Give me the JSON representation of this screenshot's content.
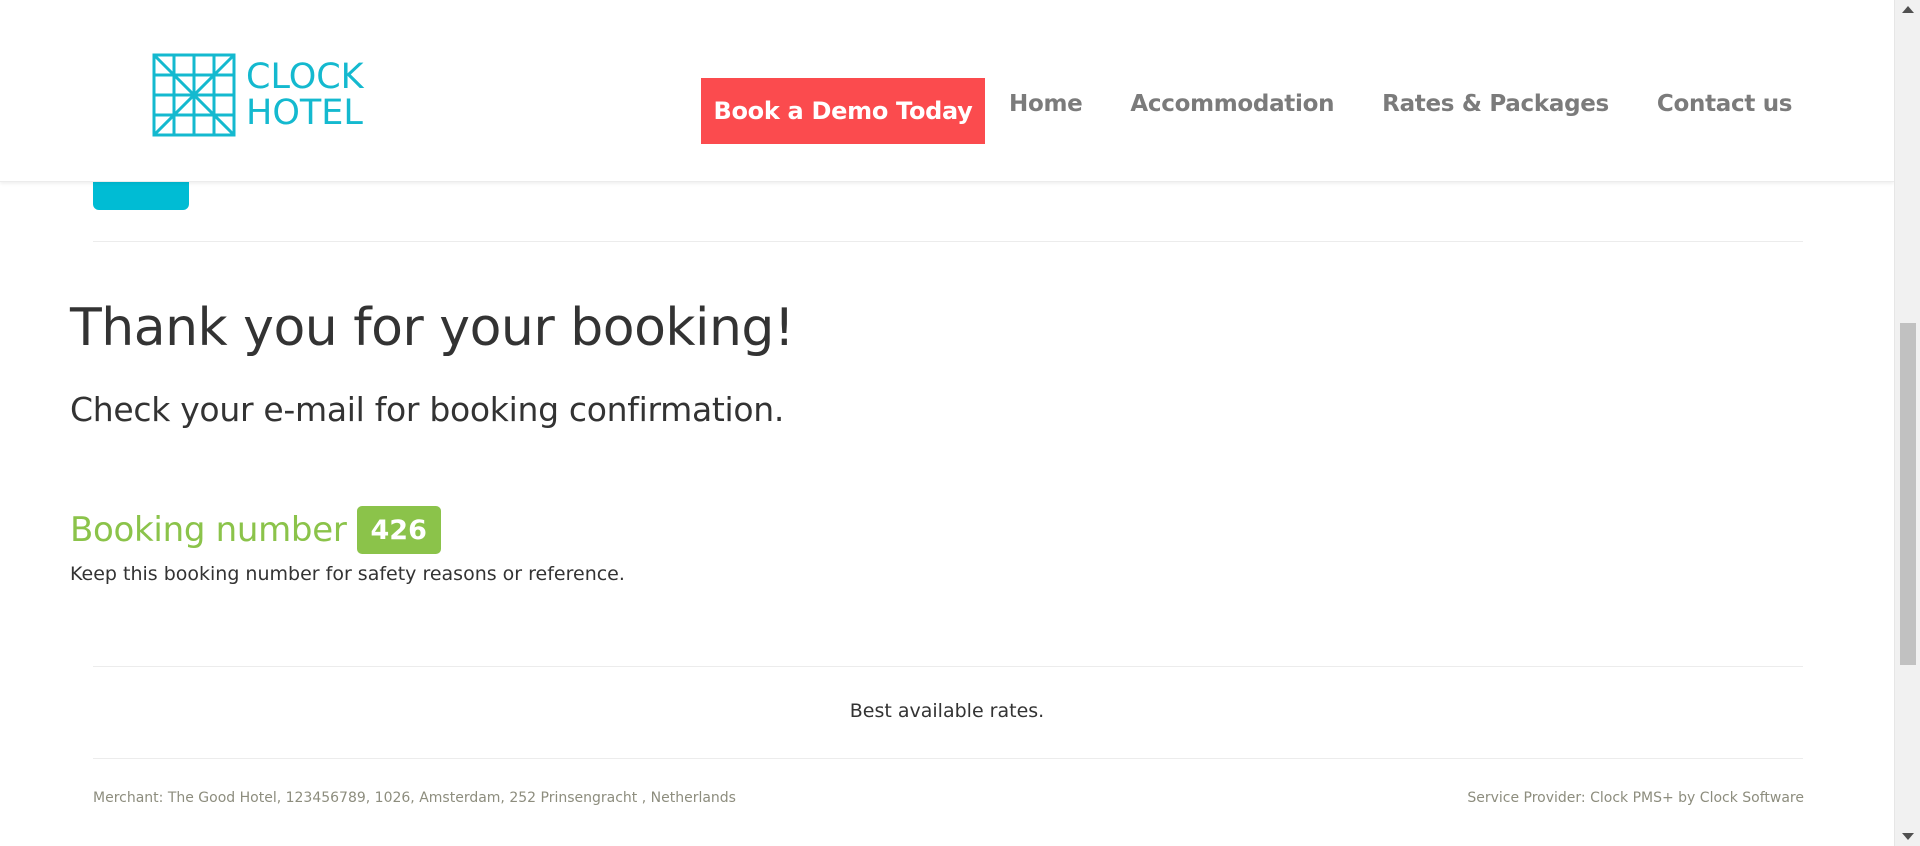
{
  "header": {
    "logo": {
      "line1": "CLOCK",
      "line2": "HOTEL",
      "icon": "clock-hotel-logo-icon",
      "color": "#14b9cf"
    },
    "demo_button_label": "Book a Demo Today",
    "demo_button_color": "#fb4b4e",
    "nav": [
      {
        "label": "Home"
      },
      {
        "label": "Accommodation"
      },
      {
        "label": "Rates & Packages"
      },
      {
        "label": "Contact us"
      }
    ]
  },
  "main": {
    "title": "Thank you for your booking!",
    "subtitle": "Check your e-mail for booking confirmation.",
    "booking_label": "Booking number",
    "booking_number": "426",
    "booking_note": "Keep this booking number for safety reasons or reference.",
    "accent_color": "#8bc34a",
    "tab_color": "#00bcd4"
  },
  "rates_text": "Best available rates.",
  "footer": {
    "merchant": "Merchant: The Good Hotel, 123456789, 1026, Amsterdam, 252 Prinsengracht , Netherlands",
    "provider": "Service Provider: Clock PMS+ by Clock Software"
  }
}
